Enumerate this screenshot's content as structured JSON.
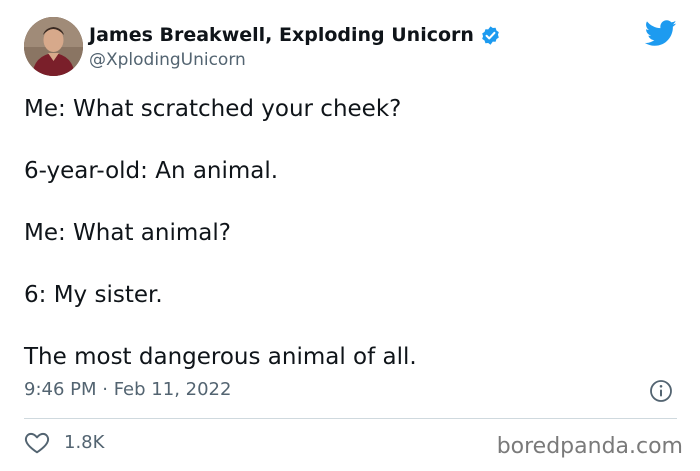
{
  "tweet": {
    "author_name": "James Breakwell, Exploding Unicorn",
    "handle": "@XplodingUnicorn",
    "lines": [
      "Me: What scratched your cheek?",
      "6-year-old: An animal.",
      "Me: What animal?",
      "6: My sister.",
      "The most dangerous animal of all."
    ],
    "timestamp": "9:46 PM · Feb 11, 2022",
    "likes": "1.8K"
  },
  "icons": {
    "verified": "verified-badge-icon",
    "logo": "twitter-bird-icon",
    "info": "info-icon",
    "like": "heart-icon"
  },
  "colors": {
    "brand_blue": "#1d9bf0",
    "text": "#0f1419",
    "secondary": "#536471",
    "divider": "#cfd9de"
  },
  "watermark": "boredpanda.com"
}
